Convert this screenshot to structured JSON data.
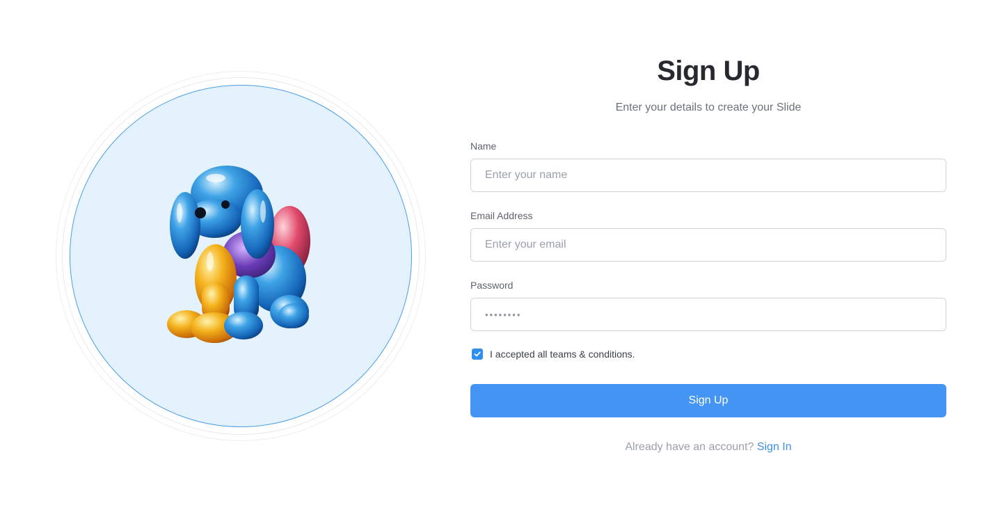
{
  "hero": {
    "image_icon": "balloon-dog-figurine"
  },
  "form": {
    "title": "Sign Up",
    "subtitle": "Enter your details to create your Slide",
    "name": {
      "label": "Name",
      "placeholder": "Enter your name",
      "value": ""
    },
    "email": {
      "label": "Email Address",
      "placeholder": "Enter your email",
      "value": ""
    },
    "password": {
      "label": "Password",
      "masked_value": "••••••••"
    },
    "terms": {
      "label": "I accepted all teams & conditions.",
      "checked": true
    },
    "submit_label": "Sign Up",
    "footer": {
      "prompt": "Already have an account?",
      "link_label": "Sign In"
    }
  },
  "colors": {
    "accent": "#4394f3",
    "link": "#3d8fe6",
    "hero_fill": "#e4f2fd",
    "hero_ring": "#4a9de8"
  }
}
